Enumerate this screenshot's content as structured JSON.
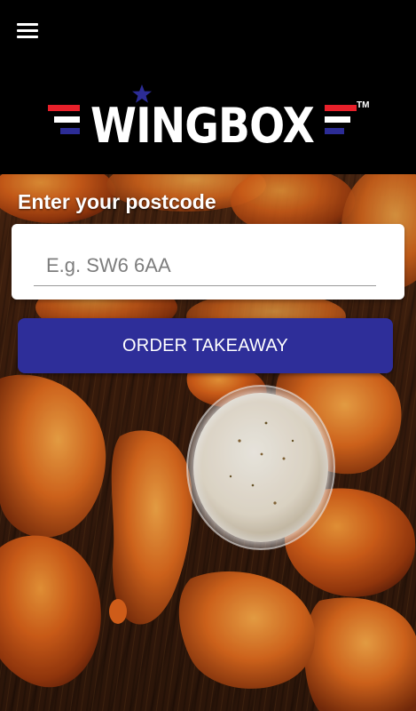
{
  "header": {
    "menu_icon": "hamburger-menu-icon",
    "logo": {
      "text": "WINGBOX",
      "trademark": "TM",
      "colors": {
        "red": "#e8202a",
        "white": "#ffffff",
        "blue": "#2c2c96",
        "background": "#000000"
      }
    }
  },
  "postcode": {
    "label": "Enter your postcode",
    "placeholder": "E.g. SW6 6AA",
    "value": ""
  },
  "order_button": {
    "label": "ORDER TAKEAWAY",
    "color": "#2e2e99"
  },
  "background_image": "chicken-wings-with-dip-photo"
}
